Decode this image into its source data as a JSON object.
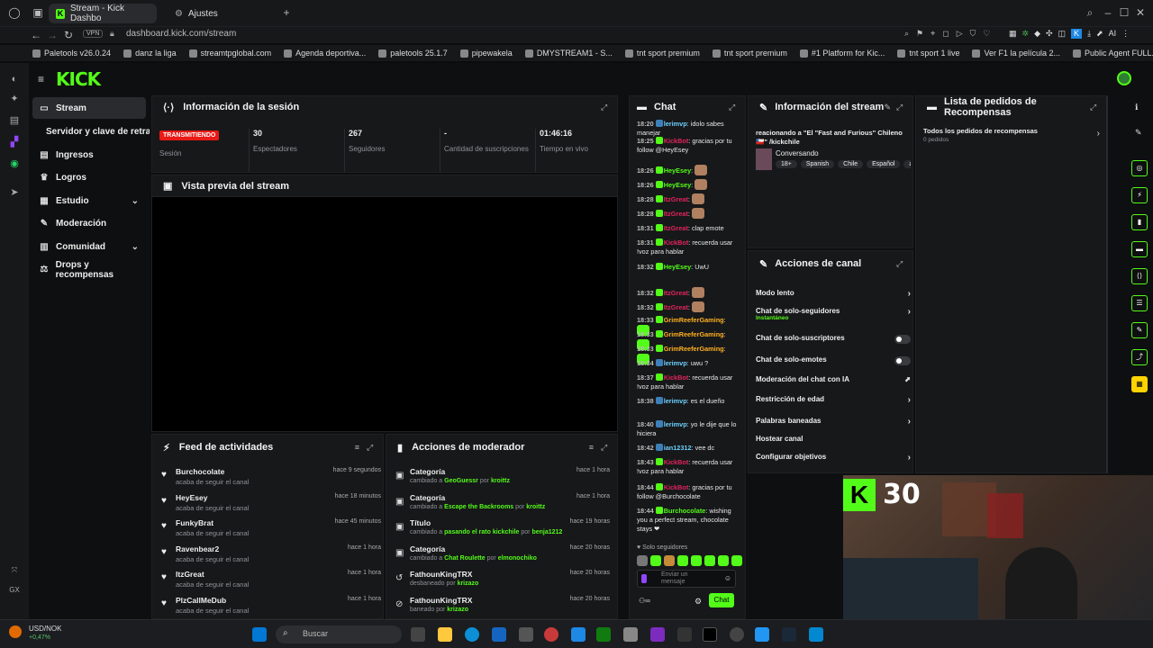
{
  "browser": {
    "tabs": [
      {
        "label": "Stream - Kick Dashbo",
        "active": true
      },
      {
        "label": "Ajustes",
        "active": false
      }
    ],
    "address": "dashboard.kick.com/stream",
    "vpn": "VPN",
    "bookmarks": [
      "Paletools v26.0.24",
      "danz la liga",
      "streamtpglobal.com",
      "Agenda deportiva...",
      "paletools 25.1.7",
      "pipewakela",
      "DMYSTREAM1 - S...",
      "tnt sport premium",
      "tnt sport premium",
      "#1 Platform for Kic...",
      "tnt sport 1 live",
      "Ver F1 la película 2...",
      "Public Agent FULL..."
    ]
  },
  "logo": "KICK",
  "sidebar": {
    "items": [
      {
        "label": "Stream",
        "icon": "stream-icon",
        "active": true
      },
      {
        "label": "Servidor y clave de retransmisión",
        "icon": "",
        "active": false
      },
      {
        "label": "Ingresos",
        "icon": "revenue-icon"
      },
      {
        "label": "Logros",
        "icon": "trophy-icon"
      },
      {
        "label": "Estudio",
        "icon": "studio-icon",
        "chevron": true
      },
      {
        "label": "Moderación",
        "icon": "shield-icon"
      },
      {
        "label": "Comunidad",
        "icon": "community-icon",
        "chevron": true
      },
      {
        "label": "Drops y recompensas",
        "icon": "gift-icon"
      }
    ]
  },
  "session": {
    "title": "Información de la sesión",
    "status": "TRANSMITIENDO",
    "status_label": "Sesión",
    "stats": [
      {
        "value": "30",
        "label": "Espectadores"
      },
      {
        "value": "267",
        "label": "Seguidores"
      },
      {
        "value": "-",
        "label": "Cantidad de suscripciones"
      },
      {
        "value": "01:46:16",
        "label": "Tiempo en vivo"
      }
    ]
  },
  "preview": {
    "title": "Vista previa del stream"
  },
  "activity": {
    "title": "Feed de actividades",
    "items": [
      {
        "name": "Burchocolate",
        "sub": "acaba de seguir el canal",
        "time": "hace 9 segundos"
      },
      {
        "name": "HeyEsey",
        "sub": "acaba de seguir el canal",
        "time": "hace 18 minutos"
      },
      {
        "name": "FunkyBrat",
        "sub": "acaba de seguir el canal",
        "time": "hace 45 minutos"
      },
      {
        "name": "Ravenbear2",
        "sub": "acaba de seguir el canal",
        "time": "hace 1 hora"
      },
      {
        "name": "ItzGreat",
        "sub": "acaba de seguir el canal",
        "time": "hace 1 hora"
      },
      {
        "name": "PlzCallMeDub",
        "sub": "acaba de seguir el canal",
        "time": "hace 1 hora"
      }
    ]
  },
  "modactions": {
    "title": "Acciones de moderador",
    "items": [
      {
        "name": "Categoría",
        "pre": "cambiado a",
        "val": "GeoGuessr",
        "mid": "por",
        "by": "kroittz",
        "time": "hace 1 hora"
      },
      {
        "name": "Categoría",
        "pre": "cambiado a",
        "val": "Escape the Backrooms",
        "mid": "por",
        "by": "kroittz",
        "time": "hace 1 hora"
      },
      {
        "name": "Título",
        "pre": "cambiado a",
        "val": "pasando el rato kickchile",
        "mid": "por",
        "by": "benja1212",
        "time": "hace 19 horas"
      },
      {
        "name": "Categoría",
        "pre": "cambiado a",
        "val": "Chat Roulette",
        "mid": "por",
        "by": "elmonochiko",
        "time": "hace 20 horas"
      },
      {
        "name": "FathounKingTRX",
        "pre": "desbaneado por",
        "val": "",
        "mid": "",
        "by": "krizazo",
        "time": "hace 20 horas"
      },
      {
        "name": "FathounKingTRX",
        "pre": "baneado por",
        "val": "",
        "mid": "",
        "by": "krizazo",
        "time": "hace 20 horas"
      }
    ]
  },
  "chat": {
    "title": "Chat",
    "messages": [
      {
        "time": "18:20",
        "user": "lerimvp",
        "color": "#6dd0ff",
        "text": "idolo sabes manejar"
      },
      {
        "time": "18:25",
        "user": "KickBot",
        "color": "#e0245e",
        "text": "gracias por tu follow @HeyEsey"
      },
      {
        "time": "18:26",
        "user": "HeyEsey",
        "color": "#53fc18",
        "text": ""
      },
      {
        "time": "18:26",
        "user": "HeyEsey",
        "color": "#53fc18",
        "text": ""
      },
      {
        "time": "18:28",
        "user": "ItzGreat",
        "color": "#e0245e",
        "text": ""
      },
      {
        "time": "18:28",
        "user": "ItzGreat",
        "color": "#e0245e",
        "text": ""
      },
      {
        "time": "18:31",
        "user": "ItzGreat",
        "color": "#e0245e",
        "text": "clap emote"
      },
      {
        "time": "18:31",
        "user": "KickBot",
        "color": "#e0245e",
        "text": "recuerda usar !voz para hablar"
      },
      {
        "time": "18:32",
        "user": "HeyEsey",
        "color": "#53fc18",
        "text": "UwU"
      },
      {
        "time": "18:32",
        "user": "ItzGreat",
        "color": "#e0245e",
        "text": ""
      },
      {
        "time": "18:32",
        "user": "ItzGreat",
        "color": "#e0245e",
        "text": ""
      },
      {
        "time": "18:33",
        "user": "GrimReeferGaming",
        "color": "#ffb020",
        "text": ""
      },
      {
        "time": "18:33",
        "user": "GrimReeferGaming",
        "color": "#ffb020",
        "text": ""
      },
      {
        "time": "18:33",
        "user": "GrimReeferGaming",
        "color": "#ffb020",
        "text": ""
      },
      {
        "time": "18:34",
        "user": "lerimvp",
        "color": "#6dd0ff",
        "text": "uwu ?"
      },
      {
        "time": "18:37",
        "user": "KickBot",
        "color": "#e0245e",
        "text": "recuerda usar !voz para hablar"
      },
      {
        "time": "18:38",
        "user": "lerimvp",
        "color": "#6dd0ff",
        "text": "es el dueño"
      },
      {
        "time": "18:40",
        "user": "lerimvp",
        "color": "#6dd0ff",
        "text": "yo le dije que lo hiciera"
      },
      {
        "time": "18:42",
        "user": "ian12312",
        "color": "#6dd0ff",
        "text": "vee dc"
      },
      {
        "time": "18:43",
        "user": "KickBot",
        "color": "#e0245e",
        "text": "recuerda usar !voz para hablar"
      },
      {
        "time": "18:44",
        "user": "KickBot",
        "color": "#e0245e",
        "text": "gracias por tu follow @Burchocolate"
      },
      {
        "time": "18:44",
        "user": "Burchocolate",
        "color": "#53fc18",
        "text": "wishing you a perfect stream, chocolate stays ❤"
      }
    ],
    "followers_only": "Solo seguidores",
    "input_placeholder": "Enviar un mensaje",
    "send_label": "Chat"
  },
  "streaminfo": {
    "title": "Información del stream",
    "stream_title": "reacionando a \"El \"Fast and Furious\" Chileno 🇨🇱\" /kickchile",
    "category": "Conversando",
    "tags": [
      "18+",
      "Spanish",
      "Chile",
      "Español",
      "au"
    ]
  },
  "channel": {
    "title": "Acciones de canal",
    "rows": [
      {
        "label": "Modo lento",
        "kind": "arrow"
      },
      {
        "label": "Chat de solo-seguidores",
        "sub": "Instantáneo",
        "kind": "arrow"
      },
      {
        "label": "Chat de solo-suscriptores",
        "kind": "toggle"
      },
      {
        "label": "Chat de solo-emotes",
        "kind": "toggle"
      },
      {
        "label": "Moderación del chat con IA",
        "kind": "ext"
      },
      {
        "label": "Restricción de edad",
        "kind": "arrow"
      },
      {
        "label": "Palabras baneadas",
        "kind": "arrow"
      },
      {
        "label": "Hostear canal",
        "kind": "none"
      },
      {
        "label": "Configurar objetivos",
        "kind": "arrow"
      }
    ]
  },
  "rewards": {
    "title": "Lista de pedidos de Recompensas",
    "all": "Todos los pedidos de recompensas",
    "count": "0 pedidos"
  },
  "webcam": {
    "viewers": "30"
  },
  "taskbar": {
    "ticker": "USD/NOK",
    "change": "+0,47%",
    "search": "Buscar"
  },
  "colors": {
    "accent": "#53fc18",
    "live": "#e91916",
    "panel": "#17181a",
    "bg": "#0e0f10"
  }
}
